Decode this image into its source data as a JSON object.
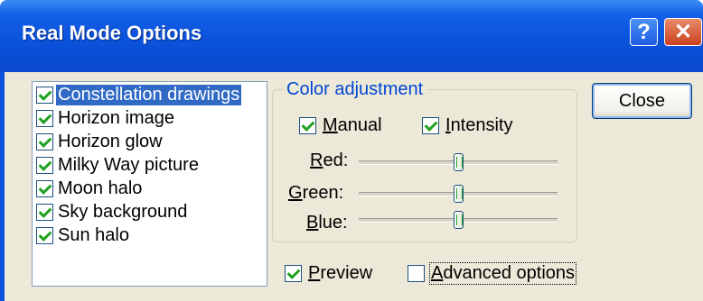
{
  "window": {
    "title": "Real Mode Options",
    "help_glyph": "?",
    "close_glyph": "✕"
  },
  "list": {
    "items": [
      {
        "label": "Constellation drawings",
        "checked": true,
        "selected": true
      },
      {
        "label": "Horizon image",
        "checked": true,
        "selected": false
      },
      {
        "label": "Horizon glow",
        "checked": true,
        "selected": false
      },
      {
        "label": "Milky Way picture",
        "checked": true,
        "selected": false
      },
      {
        "label": "Moon halo",
        "checked": true,
        "selected": false
      },
      {
        "label": "Sky background",
        "checked": true,
        "selected": false
      },
      {
        "label": "Sun halo",
        "checked": true,
        "selected": false
      }
    ]
  },
  "color": {
    "group_title": "Color adjustment",
    "manual": {
      "ul": "M",
      "rest": "anual",
      "checked": true
    },
    "intensity": {
      "ul": "I",
      "rest": "ntensity",
      "checked": true
    },
    "sliders": [
      {
        "ul": "R",
        "rest": "ed:",
        "value": 0.5
      },
      {
        "ul": "G",
        "rest": "reen:",
        "value": 0.5
      },
      {
        "ul": "B",
        "rest": "lue:",
        "value": 0.5
      }
    ]
  },
  "close_button": "Close",
  "preview": {
    "ul": "P",
    "rest": "review",
    "checked": true
  },
  "advanced": {
    "ul": "A",
    "rest": "dvanced options",
    "checked": false
  },
  "accent": "#0852dd"
}
